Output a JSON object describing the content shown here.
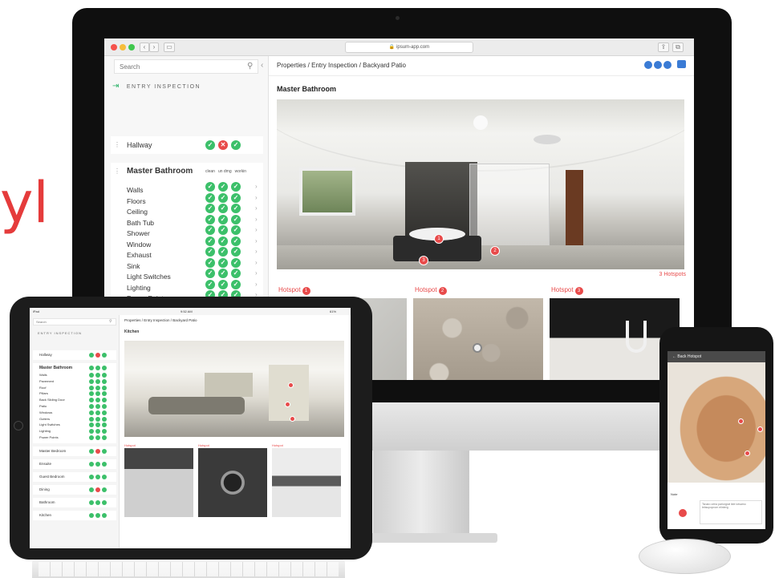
{
  "brand_fragment": "yl",
  "desktop": {
    "browser": {
      "url": "ipsum-app.com"
    },
    "search": {
      "placeholder": "Search"
    },
    "inspection": {
      "title": "ENTRY INSPECTION"
    },
    "breadcrumb": "Properties / Entry Inspection / Backyard Patio",
    "room_title": "Master Bathroom",
    "hallway": {
      "name": "Hallway",
      "statuses": [
        "ok",
        "bad",
        "ok"
      ]
    },
    "master_bathroom": {
      "name": "Master Bathroom",
      "columns": [
        "clean",
        "un dmg",
        "workin"
      ],
      "items": [
        {
          "label": "Walls"
        },
        {
          "label": "Floors"
        },
        {
          "label": "Ceiling"
        },
        {
          "label": "Bath Tub"
        },
        {
          "label": "Shower"
        },
        {
          "label": "Window"
        },
        {
          "label": "Exhaust"
        },
        {
          "label": "Sink"
        },
        {
          "label": "Light Switches"
        },
        {
          "label": "Lighting"
        },
        {
          "label": "Power Points"
        }
      ]
    },
    "hotspots": {
      "count_label": "3 Hotspots",
      "label": "Hotspot",
      "numbers": [
        "1",
        "2",
        "3"
      ]
    }
  },
  "tablet": {
    "status_left": "iPad",
    "status_time": "9:52 AM",
    "status_right": "61%",
    "search": {
      "placeholder": "Search"
    },
    "inspection": {
      "title": "ENTRY INSPECTION"
    },
    "breadcrumb": "Properties / Entry Inspection / Backyard Patio",
    "room_title": "Kitchen",
    "rooms": [
      {
        "name": "Hallway"
      },
      {
        "name": "Master Bathroom"
      },
      {
        "name": "Master Bedroom"
      },
      {
        "name": "Ensuite"
      },
      {
        "name": "Guest Bedroom"
      },
      {
        "name": "Dining"
      },
      {
        "name": "Bathroom"
      },
      {
        "name": "Kitchen"
      }
    ],
    "master_items": [
      "Walls",
      "Pavement",
      "Roof",
      "Pillars",
      "Back Sliding Door",
      "Patio",
      "Windows",
      "Gutters",
      "Light Switches",
      "Lighting",
      "Power Points"
    ],
    "hotspot_label": "Hotspot"
  },
  "phone": {
    "topbar": "← Back Hotspot",
    "footer_title": "Note",
    "note": "Tsnaro ceria pariorgrat ilde iotsamo lebsupoprom elinterg"
  }
}
